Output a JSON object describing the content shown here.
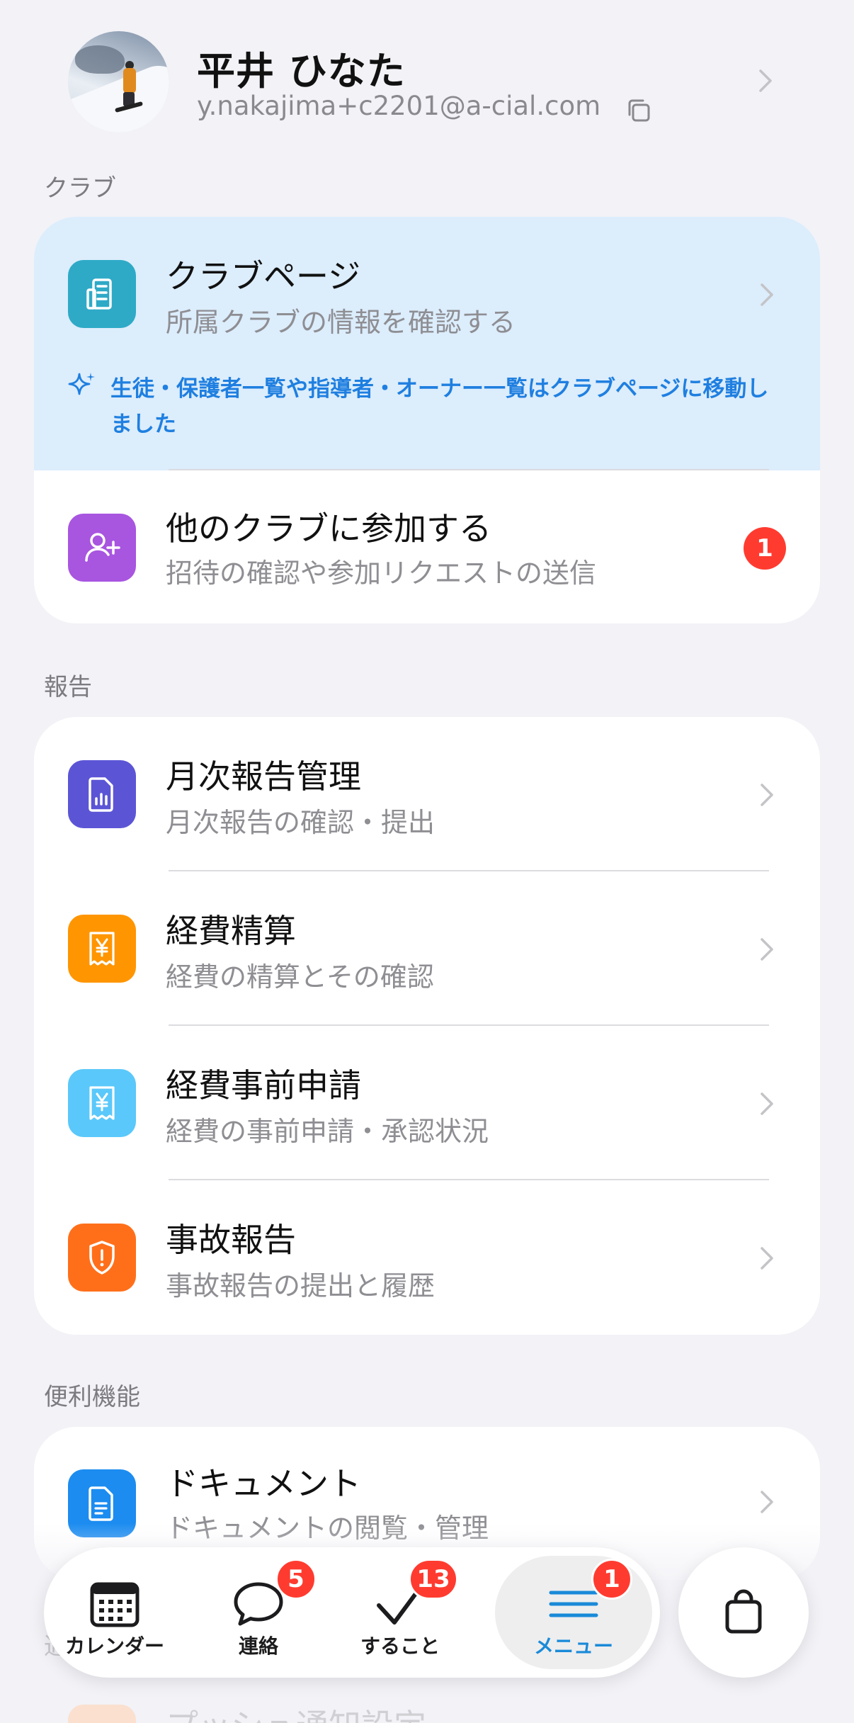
{
  "profile": {
    "name": "平井 ひなた",
    "email": "y.nakajima+c2201@a-cial.com"
  },
  "sections": {
    "club": "クラブ",
    "reports": "報告",
    "utilities": "便利機能",
    "settings_partial": "通"
  },
  "club": {
    "club_page": {
      "title": "クラブページ",
      "subtitle": "所属クラブの情報を確認する"
    },
    "notice": "生徒・保護者一覧や指導者・オーナー一覧はクラブページに移動しました",
    "join": {
      "title": "他のクラブに参加する",
      "subtitle": "招待の確認や参加リクエストの送信",
      "badge": "1"
    }
  },
  "reports": {
    "items": [
      {
        "title": "月次報告管理",
        "subtitle": "月次報告の確認・提出",
        "icon": "chart-document-icon",
        "color": "#5b55d6"
      },
      {
        "title": "経費精算",
        "subtitle": "経費の精算とその確認",
        "icon": "yen-receipt-icon",
        "color": "#ff9500"
      },
      {
        "title": "経費事前申請",
        "subtitle": "経費の事前申請・承認状況",
        "icon": "yen-receipt-icon",
        "color": "#5ac8fa"
      },
      {
        "title": "事故報告",
        "subtitle": "事故報告の提出と履歴",
        "icon": "shield-alert-icon",
        "color": "#ff6f1a"
      }
    ]
  },
  "utilities": {
    "items": [
      {
        "title": "ドキュメント",
        "subtitle": "ドキュメントの閲覧・管理",
        "icon": "document-icon",
        "color": "#1c8cf0"
      }
    ]
  },
  "partial_row": {
    "title": "プッシュ通知設定"
  },
  "nav": {
    "items": [
      {
        "label": "カレンダー",
        "icon": "calendar-icon",
        "badge": ""
      },
      {
        "label": "連絡",
        "icon": "chat-bubble-icon",
        "badge": "5"
      },
      {
        "label": "すること",
        "icon": "checkmark-icon",
        "badge": "13"
      },
      {
        "label": "メニュー",
        "icon": "menu-icon",
        "badge": "1",
        "active": true
      }
    ],
    "bag_icon": "shopping-bag-icon",
    "active_color": "#1a8ad8",
    "badge_color": "#ff3b30"
  }
}
